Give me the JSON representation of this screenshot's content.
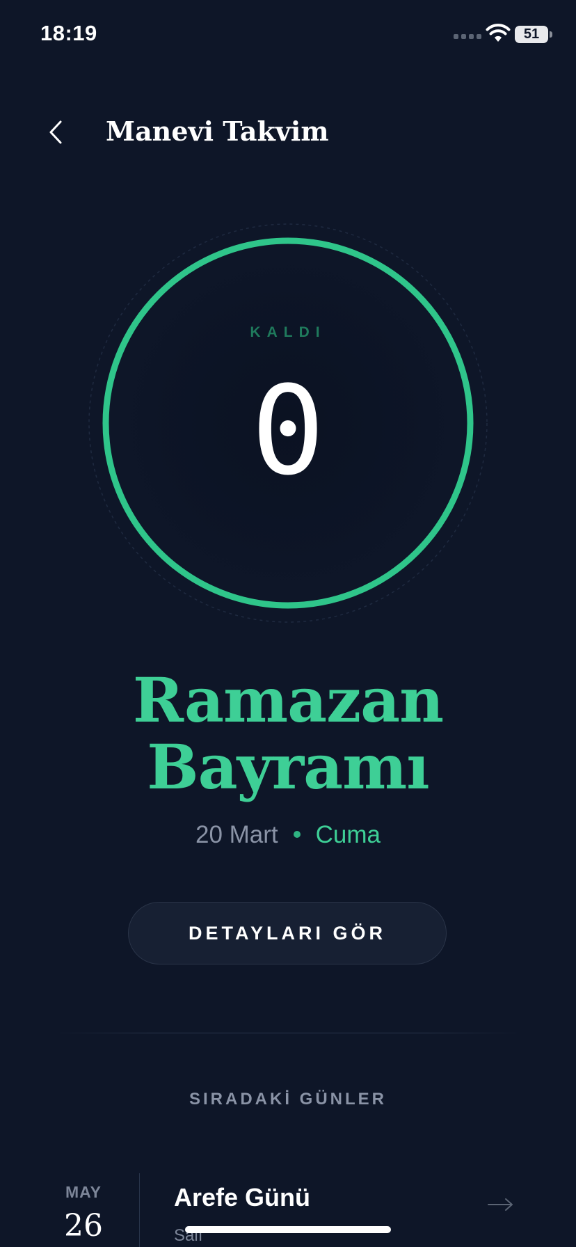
{
  "status_bar": {
    "time": "18:19",
    "battery": "51"
  },
  "header": {
    "title": "Manevi Takvim",
    "back_icon": "chevron-left-icon"
  },
  "countdown": {
    "label": "KALDI",
    "value": "0",
    "ring_color": "#2fc58a"
  },
  "event": {
    "title_line1": "Ramazan",
    "title_line2": "Bayramı",
    "date": "20 Mart",
    "day": "Cuma",
    "details_label": "DETAYLARI GÖR"
  },
  "upcoming": {
    "section_title": "SIRADAKİ GÜNLER",
    "items": [
      {
        "month": "MAY",
        "day": "26",
        "name": "Arefe Günü",
        "weekday": "Salı"
      }
    ]
  },
  "colors": {
    "background": "#0e1628",
    "accent": "#3ecf96",
    "muted": "#8a93a6"
  }
}
